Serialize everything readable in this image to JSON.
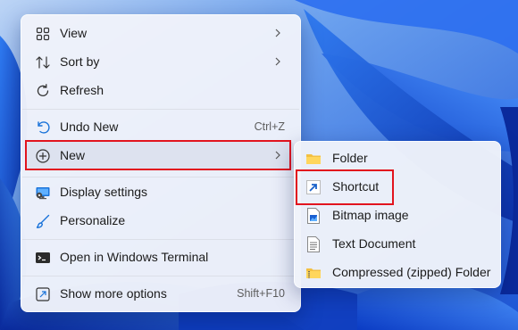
{
  "context_menu": {
    "items": [
      {
        "label": "View",
        "icon": "grid-icon",
        "submenu": true
      },
      {
        "label": "Sort by",
        "icon": "sort-icon",
        "submenu": true
      },
      {
        "label": "Refresh",
        "icon": "refresh-icon"
      },
      {
        "label": "Undo New",
        "icon": "undo-icon",
        "shortcut": "Ctrl+Z"
      },
      {
        "label": "New",
        "icon": "new-plus-icon",
        "submenu": true,
        "highlighted": true
      },
      {
        "label": "Display settings",
        "icon": "display-icon"
      },
      {
        "label": "Personalize",
        "icon": "brush-icon"
      },
      {
        "label": "Open in Windows Terminal",
        "icon": "terminal-icon"
      },
      {
        "label": "Show more options",
        "icon": "more-options-icon",
        "shortcut": "Shift+F10"
      }
    ]
  },
  "new_submenu": {
    "items": [
      {
        "label": "Folder",
        "icon": "folder-icon"
      },
      {
        "label": "Shortcut",
        "icon": "shortcut-icon",
        "highlighted": true
      },
      {
        "label": "Bitmap image",
        "icon": "bitmap-icon"
      },
      {
        "label": "Text Document",
        "icon": "text-document-icon"
      },
      {
        "label": "Compressed (zipped) Folder",
        "icon": "zip-folder-icon"
      }
    ]
  },
  "colors": {
    "highlight_box": "#e2141e",
    "menu_background": "#f0f3fa",
    "accent": "#1a73d9"
  }
}
